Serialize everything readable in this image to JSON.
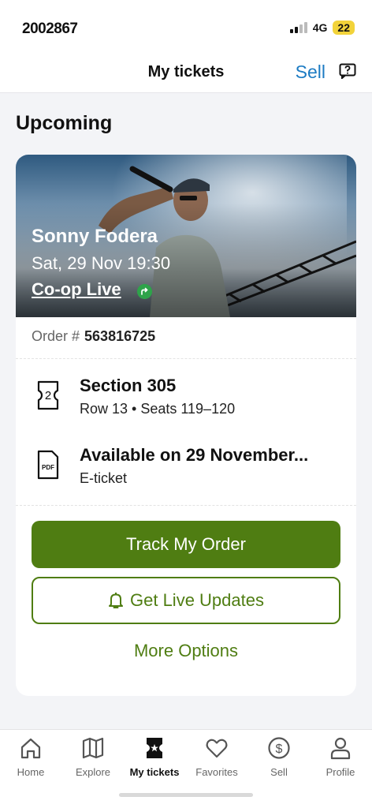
{
  "status_bar": {
    "time": "2002867",
    "network": "4G",
    "battery": "22"
  },
  "header": {
    "title": "My tickets",
    "sell_label": "Sell"
  },
  "section": {
    "heading": "Upcoming"
  },
  "event": {
    "name": "Sonny Fodera",
    "datetime": "Sat, 29 Nov 19:30",
    "venue": "Co-op Live"
  },
  "order": {
    "label": "Order #",
    "number": "563816725"
  },
  "details": {
    "seat": {
      "icon_text": "2",
      "title": "Section 305",
      "subtitle": "Row 13 • Seats 119–120"
    },
    "delivery": {
      "icon_text": "PDF",
      "title": "Available on 29 November...",
      "subtitle": "E-ticket"
    }
  },
  "actions": {
    "track": "Track My Order",
    "live_updates": "Get Live Updates",
    "more": "More Options"
  },
  "tabs": [
    {
      "label": "Home",
      "icon": "home-icon"
    },
    {
      "label": "Explore",
      "icon": "map-icon"
    },
    {
      "label": "My tickets",
      "icon": "ticket-icon"
    },
    {
      "label": "Favorites",
      "icon": "heart-icon"
    },
    {
      "label": "Sell",
      "icon": "dollar-icon"
    },
    {
      "label": "Profile",
      "icon": "user-icon"
    }
  ],
  "colors": {
    "accent_green": "#4f7d12",
    "link_blue": "#1c7bc3",
    "venue_badge": "#2ea34a"
  }
}
